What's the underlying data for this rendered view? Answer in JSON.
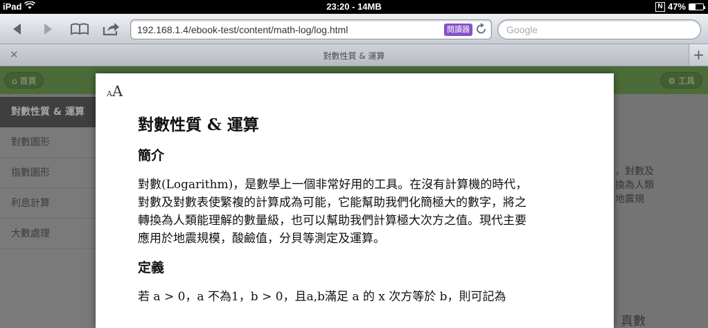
{
  "status_bar": {
    "device": "iPad",
    "center": "23:20 - 14MB",
    "battery": "47%",
    "battery_level": 0.47
  },
  "toolbar": {
    "url": "192.168.1.4/ebook-test/content/math-log/log.html",
    "reader_label": "閱讀器",
    "search_placeholder": "Google"
  },
  "tab": {
    "title": "對數性質 & 運算"
  },
  "underlying_page": {
    "home_button": "首頁",
    "tools_button": "工具",
    "sidebar": {
      "active": "對數性質 & 運算",
      "items": [
        "對數圖形",
        "指數圖形",
        "利息計算",
        "大數處理"
      ]
    },
    "snippet_lines": [
      "，對數及",
      "換為人類",
      "地震規"
    ],
    "snippet_bottom": "真數"
  },
  "reader": {
    "font_size_label_small": "A",
    "font_size_label_big": "A",
    "title": "對數性質 & 運算",
    "section1_heading": "簡介",
    "section1_lines": [
      "對數(Logarithm)，是數學上一個非常好用的工具。在沒有計算機的時代，",
      "對數及對數表使繁複的計算成為可能，它能幫助我們化簡極大的數字，將之",
      "轉換為人類能理解的數量級，也可以幫助我們計算極大次方之值。現代主要",
      "應用於地震規模，酸鹼值，分貝等測定及運算。"
    ],
    "section2_heading": "定義",
    "section2_text": "若 a > 0，a 不為1，b > 0，且a,b滿足 a 的 x 次方等於 b，則可記為"
  }
}
